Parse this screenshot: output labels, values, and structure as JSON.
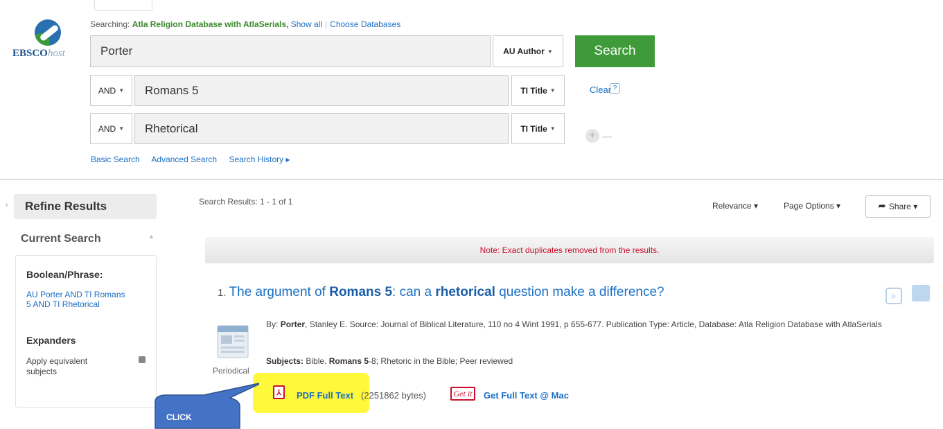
{
  "logo": {
    "text_main": "EBSCO",
    "text_host": "host"
  },
  "search_header": {
    "prefix": "Searching:",
    "database": "Atla Religion Database with AtlaSerials,",
    "show_all": "Show all",
    "choose_db": "Choose Databases"
  },
  "rows": [
    {
      "value": "Porter",
      "field": "AU Author"
    },
    {
      "bool": "AND",
      "value": "Romans 5",
      "field": "TI Title"
    },
    {
      "bool": "AND",
      "value": "Rhetorical",
      "field": "TI Title"
    }
  ],
  "search_button": "Search",
  "clear": "Clear",
  "help": "?",
  "nav": {
    "basic": "Basic Search",
    "advanced": "Advanced Search",
    "history": "Search History ▸"
  },
  "sidebar": {
    "refine": "Refine Results",
    "current": "Current Search",
    "boolean_head": "Boolean/Phrase:",
    "boolean_query": "AU Porter AND TI Romans 5 AND TI Rhetorical",
    "expanders_head": "Expanders",
    "apply_equiv": "Apply equivalent subjects"
  },
  "results": {
    "label": "Search Results:",
    "range": "1 - 1 of 1",
    "sort": "Relevance ▾",
    "page_options": "Page Options ▾",
    "share": "Share ▾",
    "note": "Note: Exact duplicates removed from the results."
  },
  "result": {
    "number": "1.",
    "title_a": "The argument of ",
    "title_b": "Romans 5",
    "title_c": ": can a ",
    "title_d": "rhetorical",
    "title_e": " question make a difference?",
    "by_label": "By:",
    "author_bold": "Porter",
    "citation": ", Stanley E. Source: Journal of Biblical Literature, 110 no 4 Wint 1991, p 655-677. Publication Type: Article, Database: Atla Religion Database with AtlaSerials",
    "subjects_label": "Subjects:",
    "subjects_pre": " Bible. ",
    "subjects_bold": "Romans 5",
    "subjects_post": "-8; Rhetoric in the Bible; Peer reviewed",
    "type_label": "Periodical",
    "pdf_link": "PDF Full Text",
    "bytes": "(2251862 bytes)",
    "getit": "Get it",
    "get_full": "Get Full Text @ Mac"
  },
  "callout": "CLICK",
  "colors": {
    "accent_green": "#3f9a3a",
    "link_blue": "#1a6fc4",
    "note_red": "#c8102e",
    "highlight": "#fff83b",
    "callout": "#4472c4"
  }
}
